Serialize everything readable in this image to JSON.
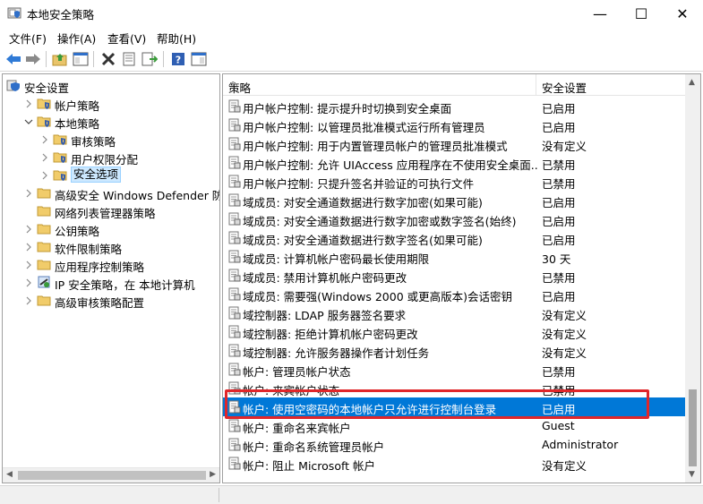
{
  "window": {
    "title": "本地安全策略",
    "minimize": "—",
    "maximize": "☐",
    "close": "✕"
  },
  "menu": [
    "文件(F)",
    "操作(A)",
    "查看(V)",
    "帮助(H)"
  ],
  "tree": [
    {
      "label": "安全设置",
      "indent": 0,
      "chevron": "",
      "icon": "shield"
    },
    {
      "label": "帐户策略",
      "indent": 1,
      "chevron": "right",
      "icon": "folder-shield"
    },
    {
      "label": "本地策略",
      "indent": 1,
      "chevron": "down",
      "icon": "folder-shield"
    },
    {
      "label": "审核策略",
      "indent": 2,
      "chevron": "right",
      "icon": "folder-shield"
    },
    {
      "label": "用户权限分配",
      "indent": 2,
      "chevron": "right",
      "icon": "folder-shield"
    },
    {
      "label": "安全选项",
      "indent": 2,
      "chevron": "right",
      "icon": "folder-shield",
      "selected": true
    },
    {
      "label": "高级安全 Windows Defender 防火墙",
      "indent": 1,
      "chevron": "right",
      "icon": "folder"
    },
    {
      "label": "网络列表管理器策略",
      "indent": 1,
      "chevron": "",
      "icon": "folder"
    },
    {
      "label": "公钥策略",
      "indent": 1,
      "chevron": "right",
      "icon": "folder"
    },
    {
      "label": "软件限制策略",
      "indent": 1,
      "chevron": "right",
      "icon": "folder"
    },
    {
      "label": "应用程序控制策略",
      "indent": 1,
      "chevron": "right",
      "icon": "folder"
    },
    {
      "label": "IP 安全策略，在 本地计算机",
      "indent": 1,
      "chevron": "right",
      "icon": "ipsec"
    },
    {
      "label": "高级审核策略配置",
      "indent": 1,
      "chevron": "right",
      "icon": "folder"
    }
  ],
  "columns": {
    "policy": "策略",
    "setting": "安全设置"
  },
  "policies": [
    {
      "name": "用户帐户控制: 提示提升时切换到安全桌面",
      "value": "已启用"
    },
    {
      "name": "用户帐户控制: 以管理员批准模式运行所有管理员",
      "value": "已启用"
    },
    {
      "name": "用户帐户控制: 用于内置管理员帐户的管理员批准模式",
      "value": "没有定义"
    },
    {
      "name": "用户帐户控制: 允许 UIAccess 应用程序在不使用安全桌面...",
      "value": "已禁用"
    },
    {
      "name": "用户帐户控制: 只提升签名并验证的可执行文件",
      "value": "已禁用"
    },
    {
      "name": "域成员: 对安全通道数据进行数字加密(如果可能)",
      "value": "已启用"
    },
    {
      "name": "域成员: 对安全通道数据进行数字加密或数字签名(始终)",
      "value": "已启用"
    },
    {
      "name": "域成员: 对安全通道数据进行数字签名(如果可能)",
      "value": "已启用"
    },
    {
      "name": "域成员: 计算机帐户密码最长使用期限",
      "value": "30 天"
    },
    {
      "name": "域成员: 禁用计算机帐户密码更改",
      "value": "已禁用"
    },
    {
      "name": "域成员: 需要强(Windows 2000 或更高版本)会话密钥",
      "value": "已启用"
    },
    {
      "name": "域控制器: LDAP 服务器签名要求",
      "value": "没有定义"
    },
    {
      "name": "域控制器: 拒绝计算机帐户密码更改",
      "value": "没有定义"
    },
    {
      "name": "域控制器: 允许服务器操作者计划任务",
      "value": "没有定义"
    },
    {
      "name": "帐户: 管理员帐户状态",
      "value": "已禁用"
    },
    {
      "name": "帐户: 来宾帐户状态",
      "value": "已禁用"
    },
    {
      "name": "帐户: 使用空密码的本地帐户只允许进行控制台登录",
      "value": "已启用",
      "selected": true
    },
    {
      "name": "帐户: 重命名来宾帐户",
      "value": "Guest"
    },
    {
      "name": "帐户: 重命名系统管理员帐户",
      "value": "Administrator"
    },
    {
      "name": "帐户: 阻止 Microsoft 帐户",
      "value": "没有定义"
    }
  ],
  "colors": {
    "selection": "#0078d7",
    "highlight_box": "#e0262a",
    "tree_selection": "#cce8ff"
  }
}
